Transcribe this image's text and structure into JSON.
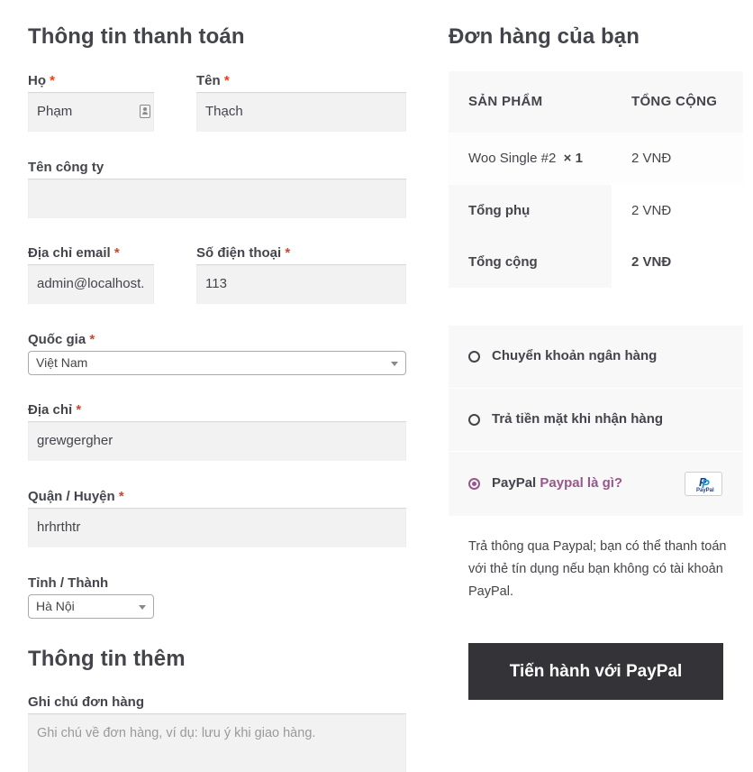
{
  "billing": {
    "heading": "Thông tin thanh toán",
    "required_mark": "*",
    "last_name": {
      "label": "Họ",
      "value": "Phạm"
    },
    "first_name": {
      "label": "Tên",
      "value": "Thạch"
    },
    "company": {
      "label": "Tên công ty",
      "value": ""
    },
    "email": {
      "label": "Địa chỉ email",
      "value": "admin@localhost."
    },
    "phone": {
      "label": "Số điện thoại",
      "value": "113"
    },
    "country": {
      "label": "Quốc gia",
      "value": "Việt Nam"
    },
    "address": {
      "label": "Địa chỉ",
      "value": "grewgergher"
    },
    "district": {
      "label": "Quận / Huyện",
      "value": "hrhrthtr"
    },
    "province": {
      "label": "Tỉnh / Thành",
      "value": "Hà Nội"
    }
  },
  "additional": {
    "heading": "Thông tin thêm",
    "notes_label": "Ghi chú đơn hàng",
    "notes_placeholder": "Ghi chú về đơn hàng, ví dụ: lưu ý khi giao hàng."
  },
  "order": {
    "heading": "Đơn hàng của bạn",
    "col_product": "SẢN PHẨM",
    "col_total": "TỔNG CỘNG",
    "item_name": "Woo Single #2",
    "item_qty": "× 1",
    "item_total": "2 VNĐ",
    "subtotal_label": "Tổng phụ",
    "subtotal_value": "2 VNĐ",
    "total_label": "Tổng cộng",
    "total_value": "2 VNĐ"
  },
  "payment": {
    "methods": [
      {
        "label": "Chuyển khoản ngân hàng",
        "selected": false
      },
      {
        "label": "Trả tiền mặt khi nhận hàng",
        "selected": false
      },
      {
        "label": "PayPal",
        "selected": true
      }
    ],
    "paypal_link": "Paypal là gì?",
    "paypal_logo_text": "PayPal",
    "description": "Trả thông qua Paypal; bạn có thể thanh toán với thẻ tín dụng nếu bạn không có tài khoản PayPal.",
    "submit_label": "Tiến hành với PayPal"
  },
  "colors": {
    "accent": "#96588a",
    "required": "#e2401c",
    "button": "#333338"
  }
}
